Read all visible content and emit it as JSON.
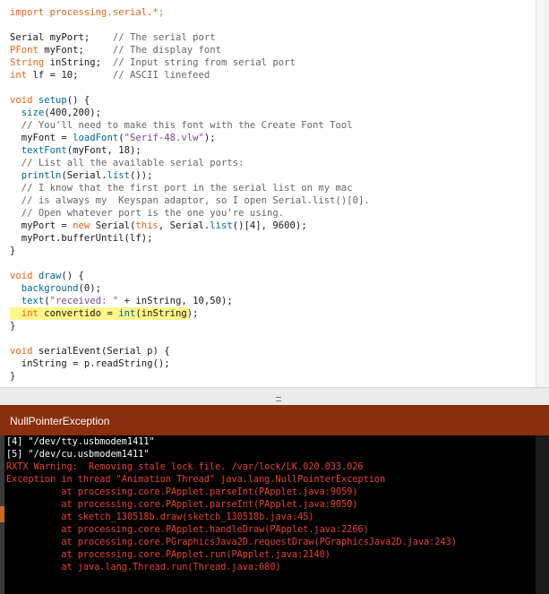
{
  "editor": {
    "code_lines": [
      [
        {
          "t": "import processing.serial.*;",
          "c": "kw"
        }
      ],
      [],
      [
        {
          "t": "Serial myPort;    ",
          "c": ""
        },
        {
          "t": "// The serial port",
          "c": "cm"
        }
      ],
      [
        {
          "t": "PFont",
          "c": "ty"
        },
        {
          "t": " myFont;     ",
          "c": ""
        },
        {
          "t": "// The display font",
          "c": "cm"
        }
      ],
      [
        {
          "t": "String",
          "c": "ty"
        },
        {
          "t": " inString;  ",
          "c": ""
        },
        {
          "t": "// Input string from serial port",
          "c": "cm"
        }
      ],
      [
        {
          "t": "int",
          "c": "ty"
        },
        {
          "t": " lf = 10;      ",
          "c": ""
        },
        {
          "t": "// ASCII linefeed",
          "c": "cm"
        }
      ],
      [],
      [
        {
          "t": "void",
          "c": "kw"
        },
        {
          "t": " ",
          "c": ""
        },
        {
          "t": "setup",
          "c": "fn"
        },
        {
          "t": "() {",
          "c": ""
        }
      ],
      [
        {
          "t": "  ",
          "c": ""
        },
        {
          "t": "size",
          "c": "fn"
        },
        {
          "t": "(400,200);",
          "c": ""
        }
      ],
      [
        {
          "t": "  // You'll need to make this font with the Create Font Tool",
          "c": "cm"
        }
      ],
      [
        {
          "t": "  myFont = ",
          "c": ""
        },
        {
          "t": "loadFont",
          "c": "fn"
        },
        {
          "t": "(",
          "c": ""
        },
        {
          "t": "\"Serif-48.vlw\"",
          "c": "st"
        },
        {
          "t": ");",
          "c": ""
        }
      ],
      [
        {
          "t": "  ",
          "c": ""
        },
        {
          "t": "textFont",
          "c": "fn"
        },
        {
          "t": "(myFont, 18);",
          "c": ""
        }
      ],
      [
        {
          "t": "  // List all the available serial ports:",
          "c": "cm"
        }
      ],
      [
        {
          "t": "  ",
          "c": ""
        },
        {
          "t": "println",
          "c": "fn"
        },
        {
          "t": "(Serial.",
          "c": ""
        },
        {
          "t": "list",
          "c": "fn"
        },
        {
          "t": "());",
          "c": ""
        }
      ],
      [
        {
          "t": "  // I know that the first port in the serial list on my mac",
          "c": "cm"
        }
      ],
      [
        {
          "t": "  // is always my  Keyspan adaptor, so I open Serial.list()[0].",
          "c": "cm"
        }
      ],
      [
        {
          "t": "  // Open whatever port is the one you're using.",
          "c": "cm"
        }
      ],
      [
        {
          "t": "  myPort = ",
          "c": ""
        },
        {
          "t": "new",
          "c": "kw"
        },
        {
          "t": " Serial(",
          "c": ""
        },
        {
          "t": "this",
          "c": "kw"
        },
        {
          "t": ", Serial.",
          "c": ""
        },
        {
          "t": "list",
          "c": "fn"
        },
        {
          "t": "()[4], 9600);",
          "c": ""
        }
      ],
      [
        {
          "t": "  myPort.bufferUntil(lf);",
          "c": ""
        }
      ],
      [
        {
          "t": "}",
          "c": ""
        }
      ],
      [],
      [
        {
          "t": "void",
          "c": "kw"
        },
        {
          "t": " ",
          "c": ""
        },
        {
          "t": "draw",
          "c": "fn"
        },
        {
          "t": "() {",
          "c": ""
        }
      ],
      [
        {
          "t": "  ",
          "c": ""
        },
        {
          "t": "background",
          "c": "fn"
        },
        {
          "t": "(0);",
          "c": ""
        }
      ],
      [
        {
          "t": "  ",
          "c": ""
        },
        {
          "t": "text",
          "c": "fn"
        },
        {
          "t": "(",
          "c": ""
        },
        {
          "t": "\"received: \"",
          "c": "st"
        },
        {
          "t": " + inString, 10,50);",
          "c": ""
        }
      ],
      [
        {
          "t": "  ",
          "c": ""
        },
        {
          "t": "int",
          "c": "ty"
        },
        {
          "t": " convertido = ",
          "c": ""
        },
        {
          "t": "int",
          "c": "fn"
        },
        {
          "t": "(inString);",
          "c": ""
        }
      ],
      [
        {
          "t": "}",
          "c": ""
        }
      ],
      [],
      [
        {
          "t": "void",
          "c": "kw"
        },
        {
          "t": " serialEvent(Serial p) {",
          "c": ""
        }
      ],
      [
        {
          "t": "  inString = p.readString();",
          "c": ""
        }
      ],
      [
        {
          "t": "}",
          "c": ""
        }
      ]
    ],
    "highlighted_line": 24
  },
  "status": {
    "message": "NullPointerException",
    "color": "#8a2f0e"
  },
  "console": {
    "lines": [
      {
        "text": "[4] \"/dev/tty.usbmodem1411\"",
        "type": "out"
      },
      {
        "text": "[5] \"/dev/cu.usbmodem1411\"",
        "type": "out"
      },
      {
        "text": "RXTX Warning:  Removing stale lock file. /var/lock/LK.020.033.026",
        "type": "err"
      },
      {
        "text": "Exception in thread \"Animation Thread\" java.lang.NullPointerException",
        "type": "err"
      },
      {
        "text": "\tat processing.core.PApplet.parseInt(PApplet.java:9059)",
        "type": "err"
      },
      {
        "text": "\tat processing.core.PApplet.parseInt(PApplet.java:9050)",
        "type": "err"
      },
      {
        "text": "\tat sketch_130518b.draw(sketch_130518b.java:45)",
        "type": "err"
      },
      {
        "text": "\tat processing.core.PApplet.handleDraw(PApplet.java:2266)",
        "type": "err"
      },
      {
        "text": "\tat processing.core.PGraphicsJava2D.requestDraw(PGraphicsJava2D.java:243)",
        "type": "err"
      },
      {
        "text": "\tat processing.core.PApplet.run(PApplet.java:2140)",
        "type": "err"
      },
      {
        "text": "\tat java.lang.Thread.run(Thread.java:680)",
        "type": "err"
      }
    ]
  }
}
